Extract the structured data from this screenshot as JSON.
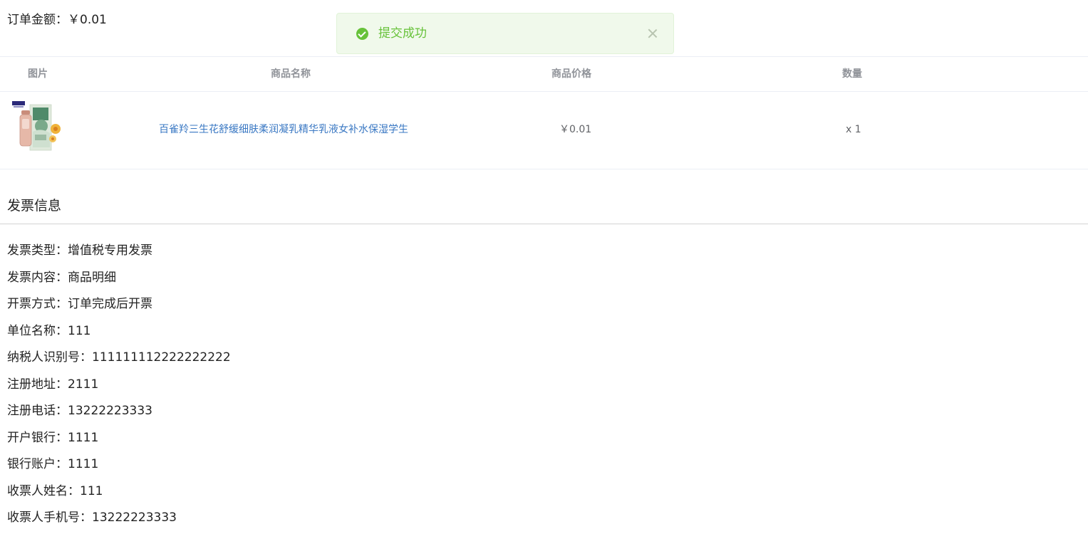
{
  "order": {
    "amount_label": "订单金额：",
    "amount_value": "￥0.01"
  },
  "toast": {
    "message": "提交成功",
    "status_color": "#67c23a"
  },
  "product_table": {
    "headers": {
      "image": "图片",
      "name": "商品名称",
      "price": "商品价格",
      "quantity": "数量"
    },
    "rows": [
      {
        "name": "百雀羚三生花舒缓细肤柔润凝乳精华乳液女补水保湿学生",
        "price": "￥0.01",
        "quantity": "x 1"
      }
    ]
  },
  "invoice": {
    "title": "发票信息",
    "fields": [
      {
        "label": "发票类型：",
        "value": "增值税专用发票"
      },
      {
        "label": "发票内容：",
        "value": "商品明细"
      },
      {
        "label": "开票方式：",
        "value": "订单完成后开票"
      },
      {
        "label": "单位名称：",
        "value": "111"
      },
      {
        "label": "纳税人识别号：",
        "value": "111111112222222222"
      },
      {
        "label": "注册地址：",
        "value": "2111"
      },
      {
        "label": "注册电话：",
        "value": "13222223333"
      },
      {
        "label": "开户银行：",
        "value": "1111"
      },
      {
        "label": "银行账户：",
        "value": "1111"
      },
      {
        "label": "收票人姓名：",
        "value": "111"
      },
      {
        "label": "收票人手机号：",
        "value": "13222223333"
      }
    ]
  }
}
